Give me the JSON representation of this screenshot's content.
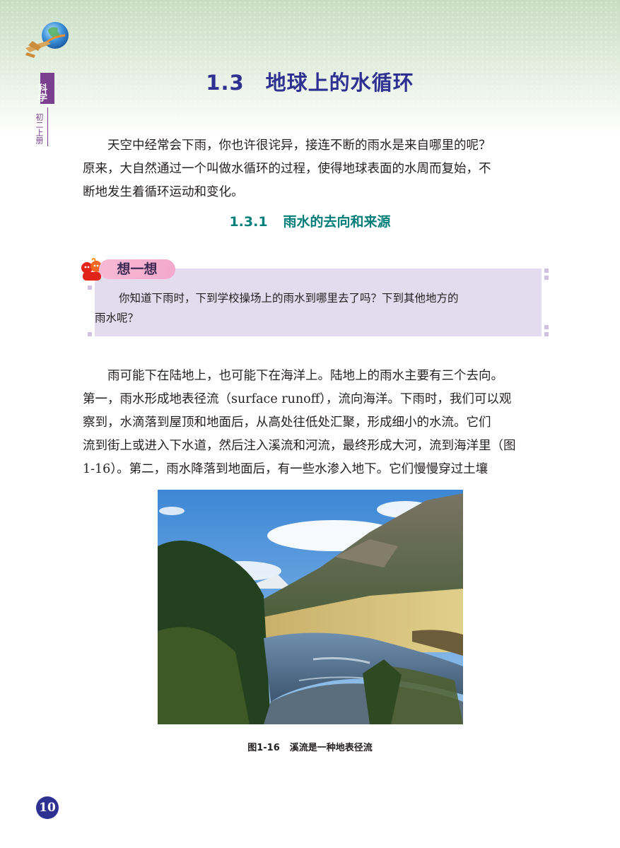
{
  "header": {
    "subject_label": "科学",
    "grade_label": "初二上册"
  },
  "chapter": {
    "number": "1.3",
    "title": "地球上的水循环"
  },
  "intro_lines": [
    "天空中经常会下雨，你也许很诧异，接连不断的雨水是来自哪里的呢？",
    "原来，大自然通过一个叫做水循环的过程，使得地球表面的水周而复始，不",
    "断地发生着循环运动和变化。"
  ],
  "section": {
    "number": "1.3.1",
    "title": "雨水的去向和来源"
  },
  "think": {
    "label": "想一想",
    "lines": [
      "你知道下雨时，下到学校操场上的雨水到哪里去了吗？下到其他地方的",
      "雨水呢？"
    ]
  },
  "body_lines": [
    "雨可能下在陆地上，也可能下在海洋上。陆地上的雨水主要有三个去向。",
    "第一，雨水形成地表径流（surface runoff），流向海洋。下雨时，我们可以观",
    "察到，水滴落到屋顶和地面后，从高处往低处汇聚，形成细小的水流。它们",
    "流到街上或进入下水道，然后注入溪流和河流，最终形成大河，流到海洋里（图",
    "1-16）。第二，雨水降落到地面后，有一些水渗入地下。它们慢慢穿过土壤"
  ],
  "figure": {
    "number": "图1-16",
    "caption": "溪流是一种地表径流"
  },
  "page_number": "10",
  "colors": {
    "title": "#2e3192",
    "section": "#007f7a",
    "think_bg": "#e3dcee",
    "think_label": "#f4a9cc",
    "side_tab": "#7a3f8f"
  }
}
